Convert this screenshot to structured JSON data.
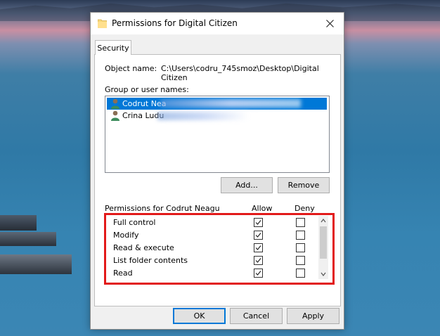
{
  "window": {
    "title": "Permissions for Digital Citizen"
  },
  "tabs": [
    {
      "label": "Security"
    }
  ],
  "object": {
    "label": "Object name:",
    "value": "C:\\Users\\codru_745smoz\\Desktop\\Digital Citizen"
  },
  "group": {
    "label": "Group or user names:",
    "users": [
      {
        "name": "Codrut Nea",
        "selected": true
      },
      {
        "name": "Crina Ludu",
        "selected": false
      }
    ]
  },
  "buttons": {
    "add": "Add...",
    "remove": "Remove",
    "ok": "OK",
    "cancel": "Cancel",
    "apply": "Apply"
  },
  "permissions": {
    "label": "Permissions for Codrut Neagu",
    "allow_header": "Allow",
    "deny_header": "Deny",
    "rows": [
      {
        "name": "Full control",
        "allow": true,
        "deny": false
      },
      {
        "name": "Modify",
        "allow": true,
        "deny": false
      },
      {
        "name": "Read & execute",
        "allow": true,
        "deny": false
      },
      {
        "name": "List folder contents",
        "allow": true,
        "deny": false
      },
      {
        "name": "Read",
        "allow": true,
        "deny": false
      }
    ]
  },
  "colors": {
    "selection": "#0078d7",
    "highlight": "#e21a1a"
  }
}
